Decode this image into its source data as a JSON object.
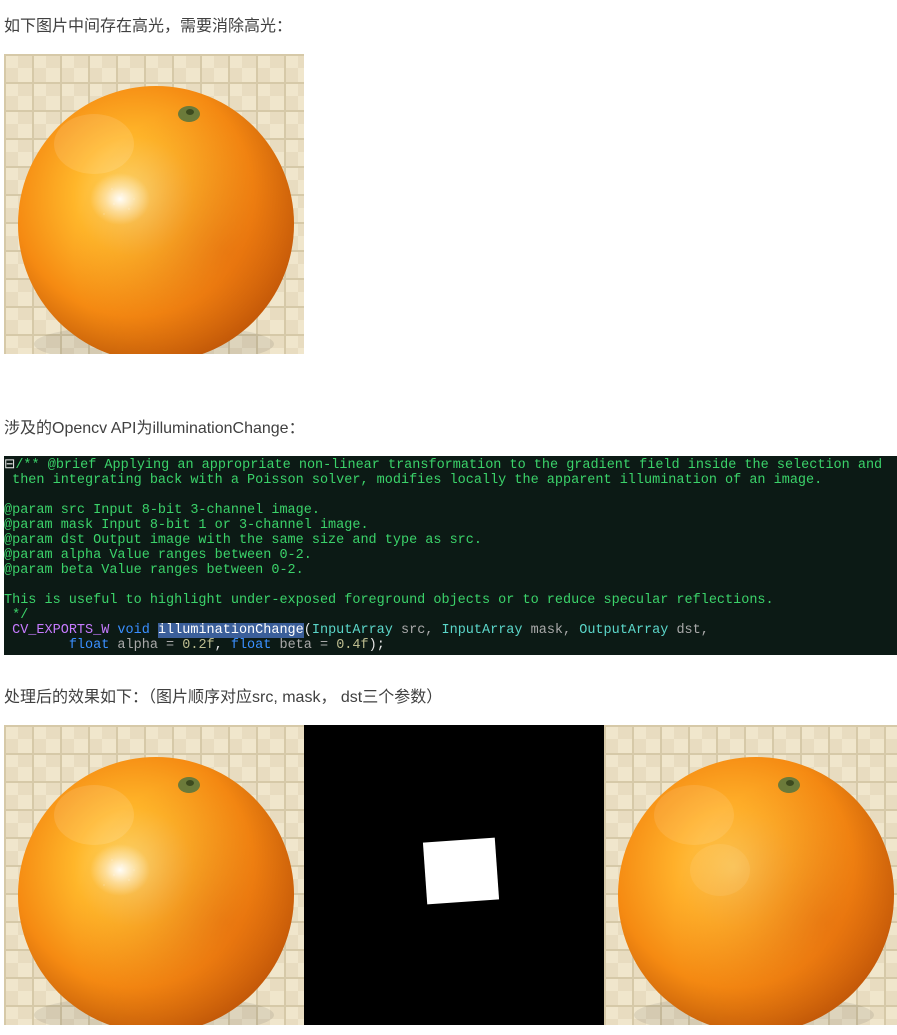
{
  "text": {
    "para1": "如下图片中间存在高光，需要消除高光：",
    "para2": "涉及的Opencv API为illuminationChange：",
    "para3": "处理后的效果如下：（图片顺序对应src, mask， dst三个参数）"
  },
  "code": {
    "l1a": "/** @brief Applying an appropriate non-linear transformation to the gradient field inside the selection and",
    "l2": " then integrating back with a Poisson solver, modifies locally the apparent illumination of an image.",
    "l3": "",
    "l4": "@param src Input 8-bit 3-channel image.",
    "l5": "@param mask Input 8-bit 1 or 3-channel image.",
    "l6": "@param dst Output image with the same size and type as src.",
    "l7": "@param alpha Value ranges between 0-2.",
    "l8": "@param beta Value ranges between 0-2.",
    "l9": "",
    "l10": "This is useful to highlight under-exposed foreground objects or to reduce specular reflections.",
    "l11": " */",
    "l12_cv": "CV_EXPORTS_W",
    "l12_void": " void ",
    "l12_fn": "illuminationChange",
    "l12_p1": "(",
    "l12_ia1": "InputArray",
    "l12_src": " src, ",
    "l12_ia2": "InputArray",
    "l12_mask": " mask, ",
    "l12_oa": "OutputArray",
    "l12_dst": " dst,",
    "l13_sp": "        ",
    "l13_fl1": "float",
    "l13_a": " alpha = ",
    "l13_n1": "0.2f",
    "l13_c": ", ",
    "l13_fl2": "float",
    "l13_b": " beta = ",
    "l13_n2": "0.4f",
    "l13_end": ");"
  }
}
